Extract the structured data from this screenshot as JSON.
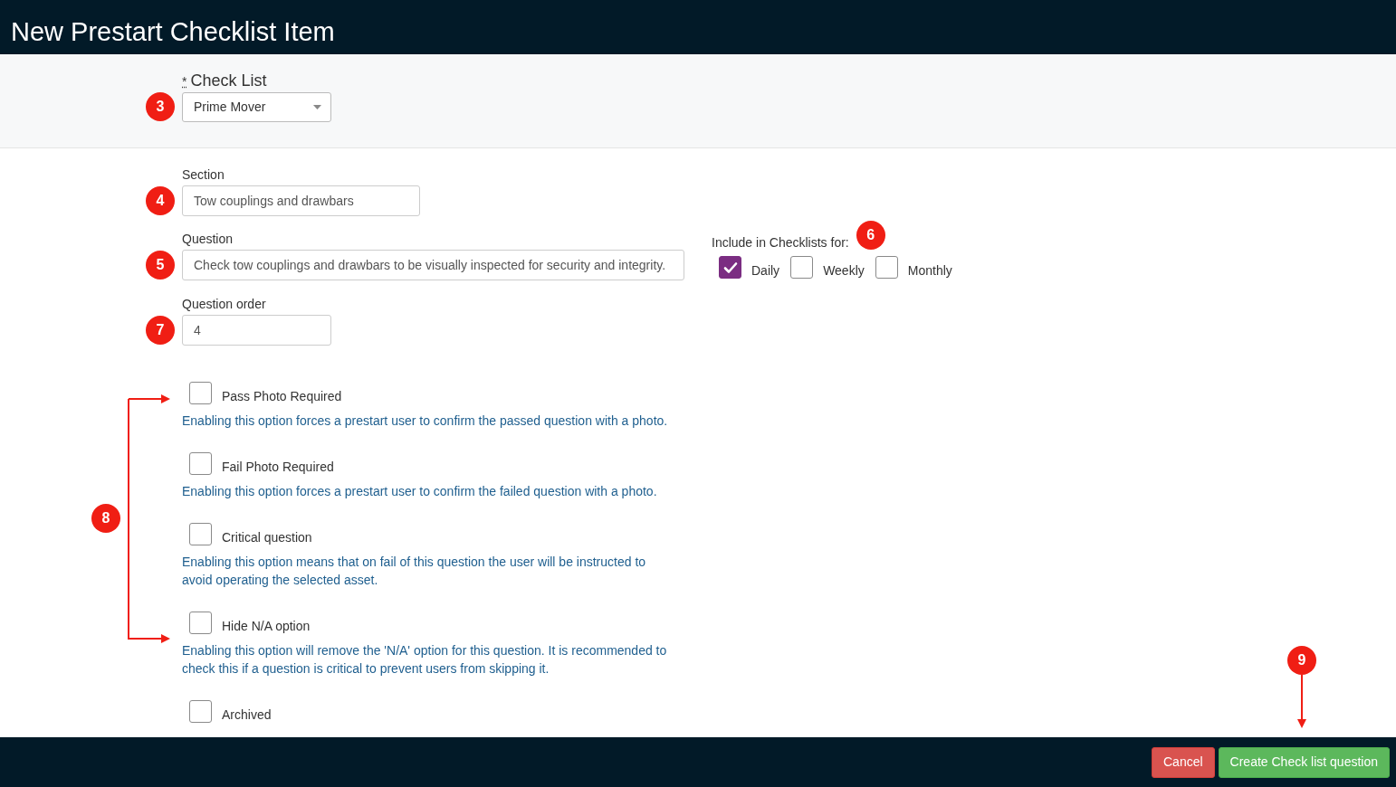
{
  "header": {
    "title": "New Prestart Checklist Item"
  },
  "check_list": {
    "required_mark": "*",
    "label": "Check List",
    "value": "Prime Mover",
    "badge": "3"
  },
  "section": {
    "label": "Section",
    "value": "Tow couplings and drawbars",
    "badge": "4"
  },
  "question": {
    "label": "Question",
    "value": "Check tow couplings and drawbars to be visually inspected for security and integrity.",
    "badge": "5"
  },
  "include": {
    "label": "Include in Checklists for:",
    "badge": "6",
    "options": [
      {
        "label": "Daily",
        "checked": true
      },
      {
        "label": "Weekly",
        "checked": false
      },
      {
        "label": "Monthly",
        "checked": false
      }
    ]
  },
  "question_order": {
    "label": "Question order",
    "value": "4",
    "badge": "7"
  },
  "options_badge": "8",
  "options": [
    {
      "label": "Pass Photo Required",
      "checked": false,
      "help": "Enabling this option forces a prestart user to confirm the passed question with a photo."
    },
    {
      "label": "Fail Photo Required",
      "checked": false,
      "help": "Enabling this option forces a prestart user to confirm the failed question with a photo."
    },
    {
      "label": "Critical question",
      "checked": false,
      "help": "Enabling this option means that on fail of this question the user will be instructed to avoid operating the selected asset."
    },
    {
      "label": "Hide N/A option",
      "checked": false,
      "help": "Enabling this option will remove the 'N/A' option for this question. It is recommended to check this if a question is critical to prevent users from skipping it."
    },
    {
      "label": "Archived",
      "checked": false
    }
  ],
  "footer": {
    "buttons": [
      {
        "kind": "cancel",
        "label": "Cancel"
      },
      {
        "kind": "primary",
        "label": "Create Check list question",
        "badge": "9"
      }
    ]
  }
}
